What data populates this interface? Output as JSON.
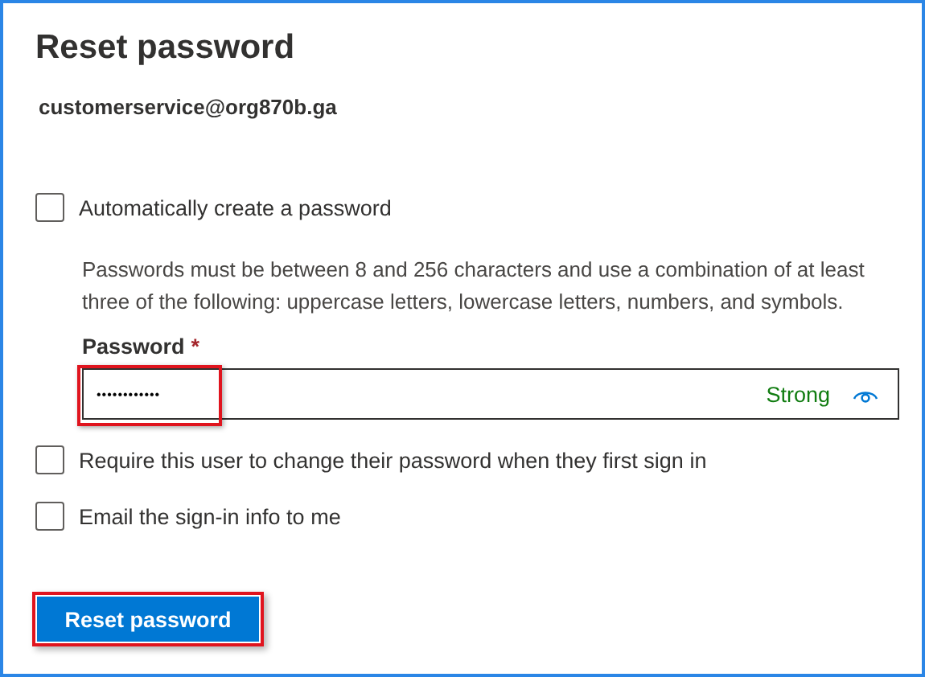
{
  "title": "Reset password",
  "account": "customerservice@org870b.ga",
  "options_top": [
    {
      "label": "Automatically create a password",
      "checked": false
    }
  ],
  "help_text": "Passwords must be between 8 and 256 characters and use a combination of at least three of the following: uppercase letters, lowercase letters, numbers, and symbols.",
  "password": {
    "label": "Password",
    "required_mark": "*",
    "value": "••••••••••••",
    "strength": "Strong",
    "highlighted": true
  },
  "options": [
    {
      "label": "Require this user to change their password when they first sign in",
      "checked": false
    },
    {
      "label": "Email the sign-in info to me",
      "checked": false
    }
  ],
  "button": {
    "label": "Reset password",
    "highlighted": true
  }
}
